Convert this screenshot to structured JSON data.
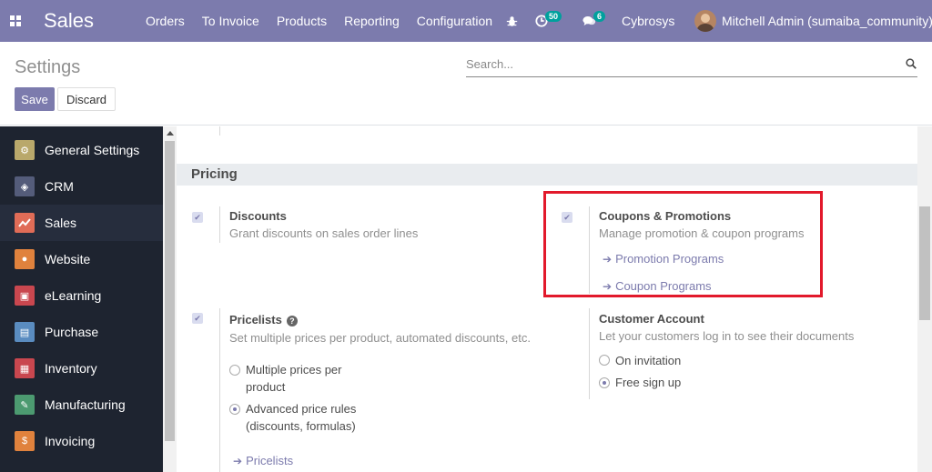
{
  "navbar": {
    "app_title": "Sales",
    "menu": [
      "Orders",
      "To Invoice",
      "Products",
      "Reporting",
      "Configuration"
    ],
    "activity_count": "50",
    "message_count": "6",
    "company": "Cybrosys",
    "user": "Mitchell Admin (sumaiba_community)",
    "color": "#7c7bad",
    "badge_color": "#00a09d"
  },
  "control_panel": {
    "title": "Settings",
    "search_placeholder": "Search...",
    "save_label": "Save",
    "discard_label": "Discard"
  },
  "sidebar": {
    "items": [
      {
        "label": "General Settings",
        "icon": "gear-icon",
        "color": "#b9a86b",
        "active": false
      },
      {
        "label": "CRM",
        "icon": "handshake-icon",
        "color": "#545c7a",
        "active": false
      },
      {
        "label": "Sales",
        "icon": "chart-icon",
        "color": "#e06c57",
        "active": true
      },
      {
        "label": "Website",
        "icon": "globe-icon",
        "color": "#e0823d",
        "active": false
      },
      {
        "label": "eLearning",
        "icon": "elearning-icon",
        "color": "#c9474f",
        "active": false
      },
      {
        "label": "Purchase",
        "icon": "purchase-icon",
        "color": "#5a8cc0",
        "active": false
      },
      {
        "label": "Inventory",
        "icon": "box-icon",
        "color": "#c9474f",
        "active": false
      },
      {
        "label": "Manufacturing",
        "icon": "wrench-icon",
        "color": "#4c9a70",
        "active": false
      },
      {
        "label": "Invoicing",
        "icon": "invoice-icon",
        "color": "#e0823d",
        "active": false
      }
    ]
  },
  "pricing": {
    "section_title": "Pricing",
    "discounts": {
      "title": "Discounts",
      "description": "Grant discounts on sales order lines"
    },
    "coupons": {
      "title": "Coupons & Promotions",
      "description": "Manage promotion & coupon programs",
      "links": [
        "Promotion Programs",
        "Coupon Programs"
      ]
    },
    "pricelists": {
      "title": "Pricelists",
      "description": "Set multiple prices per product, automated discounts, etc.",
      "options": [
        {
          "line1": "Multiple prices per",
          "line2": "product",
          "selected": false
        },
        {
          "line1": "Advanced price rules",
          "line2": "(discounts, formulas)",
          "selected": true
        }
      ],
      "link": "Pricelists"
    },
    "customer_account": {
      "title": "Customer Account",
      "description": "Let your customers log in to see their documents",
      "options": [
        {
          "label": "On invitation",
          "selected": false
        },
        {
          "label": "Free sign up",
          "selected": true
        }
      ]
    }
  },
  "highlight_color": "#e2192b"
}
